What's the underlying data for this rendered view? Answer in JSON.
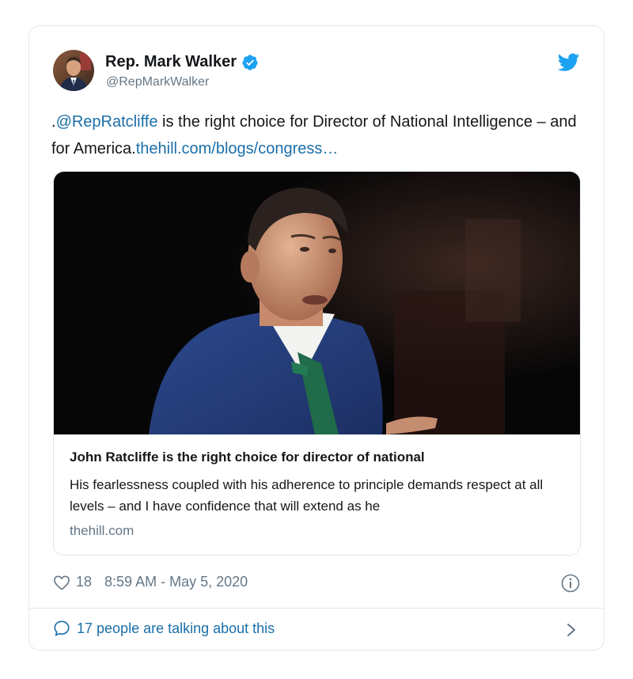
{
  "tweet": {
    "author": {
      "display_name": "Rep. Mark Walker",
      "handle": "@RepMarkWalker",
      "verified": true,
      "avatar_icon": "avatar-photo"
    },
    "platform_icon": "twitter-bird-icon",
    "text": {
      "prefix": ".",
      "mention": "@RepRatcliffe",
      "body": " is the right choice for Director of National Intelligence – and for America.",
      "link": "thehill.com/blogs/congress…"
    },
    "card": {
      "title": "John Ratcliffe is the right choice for director of national",
      "description": "His fearlessness coupled with his adherence to principle demands respect at all levels – and I have confidence that will extend as he",
      "domain": "thehill.com"
    },
    "meta": {
      "likes": "18",
      "timestamp": "8:59 AM - May 5, 2020"
    },
    "conversation": {
      "label": "17 people are talking about this"
    },
    "colors": {
      "link": "#1b6fa8",
      "brand": "#1da1f2",
      "muted": "#657786",
      "border": "#e1e8ed"
    }
  }
}
